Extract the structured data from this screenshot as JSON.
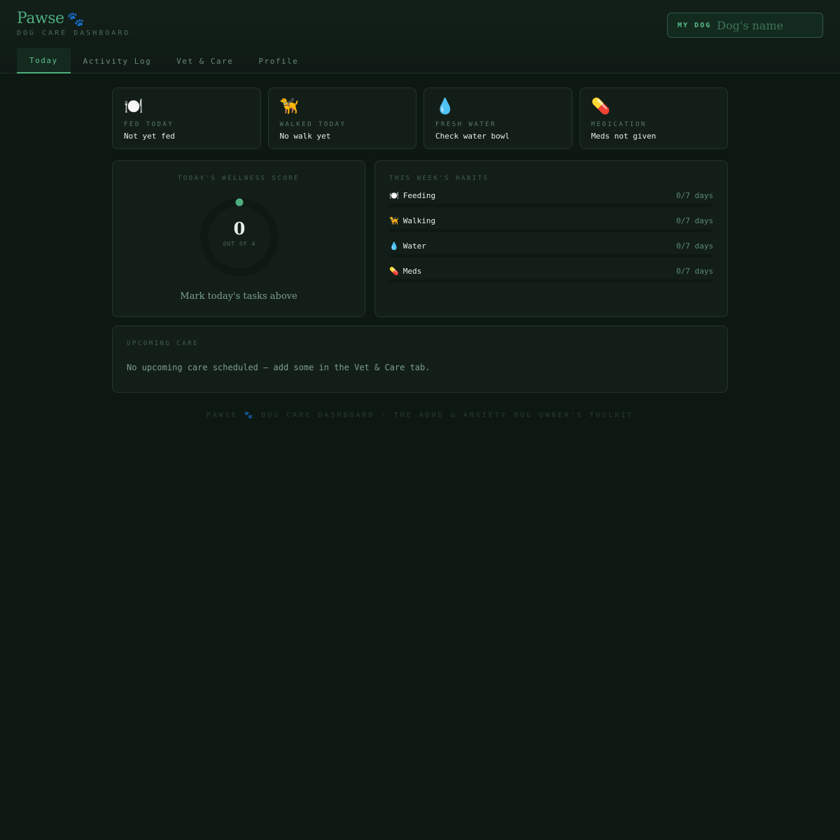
{
  "app": {
    "title": "Pawse",
    "paw": "🐾",
    "subtitle": "DOG CARE DASHBOARD"
  },
  "dog": {
    "label": "MY DOG",
    "placeholder": "Dog's name",
    "value": ""
  },
  "tabs": [
    {
      "label": "Today",
      "active": true
    },
    {
      "label": "Activity Log",
      "active": false
    },
    {
      "label": "Vet & Care",
      "active": false
    },
    {
      "label": "Profile",
      "active": false
    }
  ],
  "status_cards": [
    {
      "icon": "🍽️",
      "icon_name": "plate-icon",
      "label": "FED TODAY",
      "value": "Not yet fed"
    },
    {
      "icon": "🦮",
      "icon_name": "guide-dog-icon",
      "label": "WALKED TODAY",
      "value": "No walk yet"
    },
    {
      "icon": "💧",
      "icon_name": "water-drop-icon",
      "label": "FRESH WATER",
      "value": "Check water bowl"
    },
    {
      "icon": "💊",
      "icon_name": "pill-icon",
      "label": "MEDICATION",
      "value": "Meds not given"
    }
  ],
  "wellness": {
    "title": "TODAY'S WELLNESS SCORE",
    "score": "0",
    "out_of": "OUT OF 4",
    "progress": 0,
    "message": "Mark today's tasks above"
  },
  "habits": {
    "title": "THIS WEEK'S HABITS",
    "items": [
      {
        "icon": "🍽️",
        "icon_name": "plate-icon",
        "name": "Feeding",
        "count": "0/7 days",
        "progress": 0
      },
      {
        "icon": "🦮",
        "icon_name": "guide-dog-icon",
        "name": "Walking",
        "count": "0/7 days",
        "progress": 0
      },
      {
        "icon": "💧",
        "icon_name": "water-drop-icon",
        "name": "Water",
        "count": "0/7 days",
        "progress": 0
      },
      {
        "icon": "💊",
        "icon_name": "pill-icon",
        "name": "Meds",
        "count": "0/7 days",
        "progress": 0
      }
    ]
  },
  "upcoming": {
    "title": "UPCOMING CARE",
    "message": "No upcoming care scheduled — add some in the Vet & Care tab."
  },
  "footer": {
    "left": "PAWSE",
    "paw": "🐾",
    "right": "DOG CARE DASHBOARD · THE ADHD & ANXIETY DOG OWNER'S TOOLKIT"
  },
  "colors": {
    "accent": "#4caf7d",
    "background": "#0e1813",
    "card": "#131e18"
  }
}
